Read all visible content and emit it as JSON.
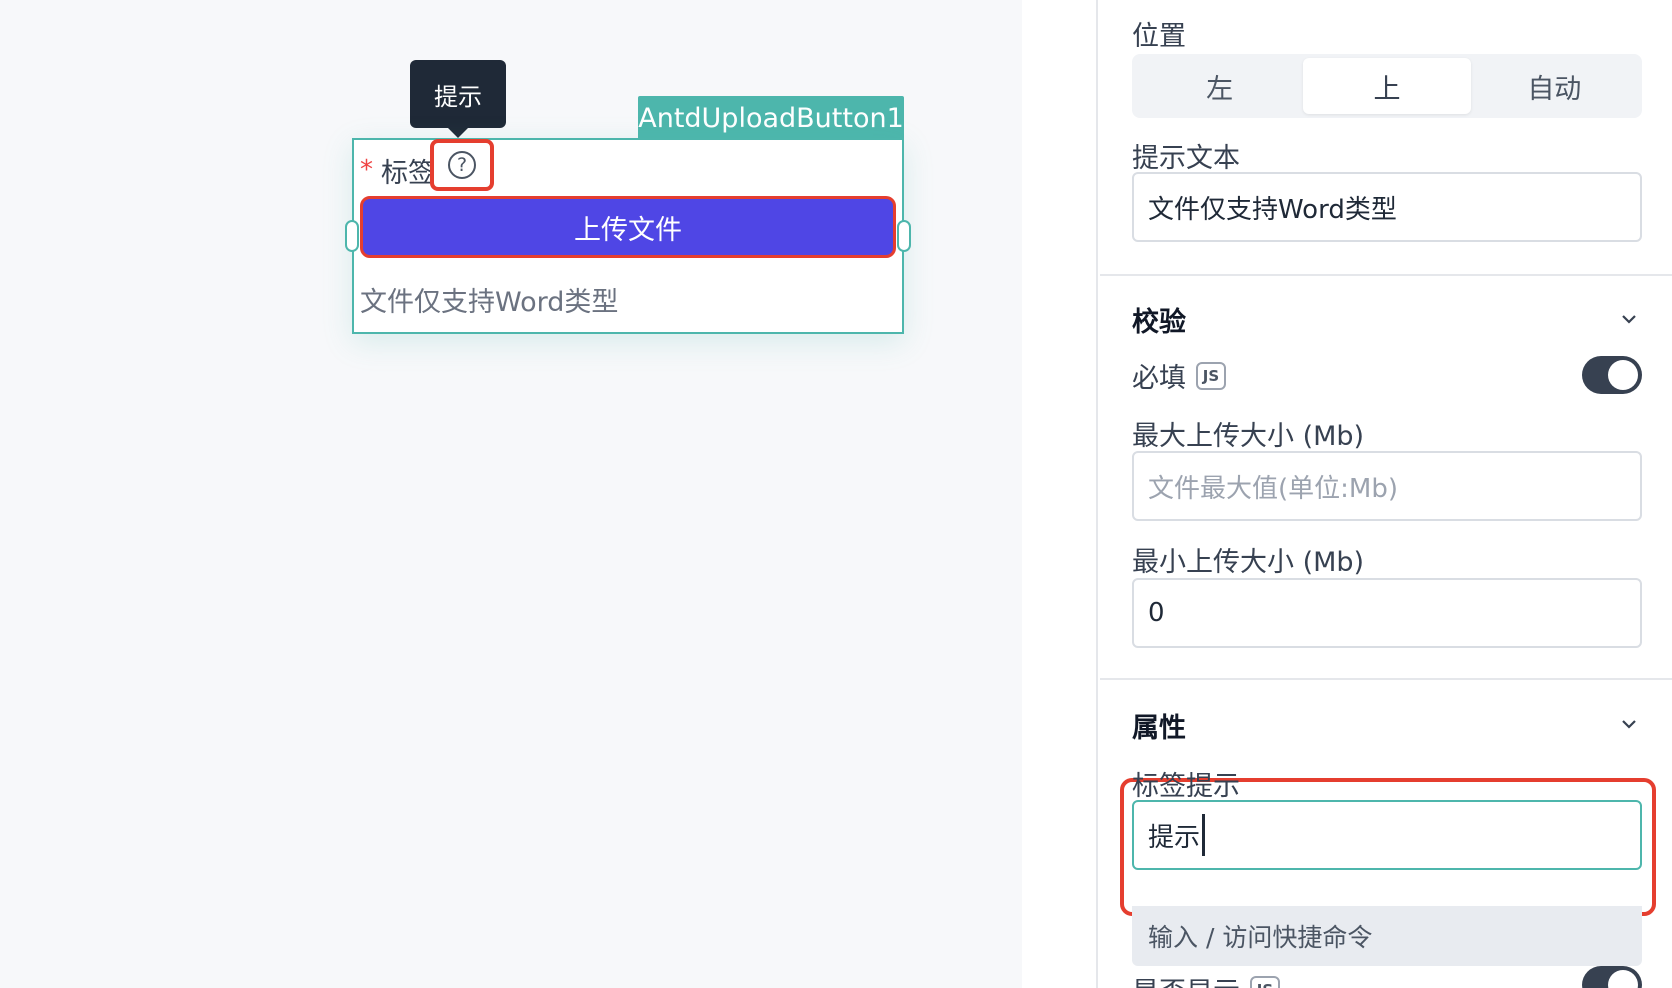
{
  "canvas": {
    "tooltip": "提示",
    "component_name": "AntdUploadButton1",
    "label": "标签",
    "required_mark": "*",
    "help_glyph": "?",
    "upload_button": "上传文件",
    "hint": "文件仅支持Word类型"
  },
  "panel": {
    "position": {
      "label": "位置",
      "options": [
        "左",
        "上",
        "自动"
      ],
      "selected": "上"
    },
    "hint_text": {
      "label": "提示文本",
      "value": "文件仅支持Word类型"
    },
    "validation": {
      "title": "校验",
      "required_label": "必填",
      "required_badge": "JS",
      "required_on": true,
      "max_size_label": "最大上传大小 (Mb)",
      "max_size_placeholder": "文件最大值(单位:Mb)",
      "min_size_label": "最小上传大小 (Mb)",
      "min_size_value": "0"
    },
    "properties": {
      "title": "属性",
      "label_tip_label": "标签提示",
      "label_tip_value": "提示",
      "command_hint": "输入 / 访问快捷命令",
      "show_label": "是否显示",
      "show_badge": "JS"
    }
  },
  "colors": {
    "accent_teal": "#4db6ac",
    "primary_button": "#4f46e5",
    "highlight_red": "#e53e2f",
    "toggle_on": "#374151"
  },
  "icons": [
    "question-circle-icon",
    "chevron-down-icon"
  ]
}
